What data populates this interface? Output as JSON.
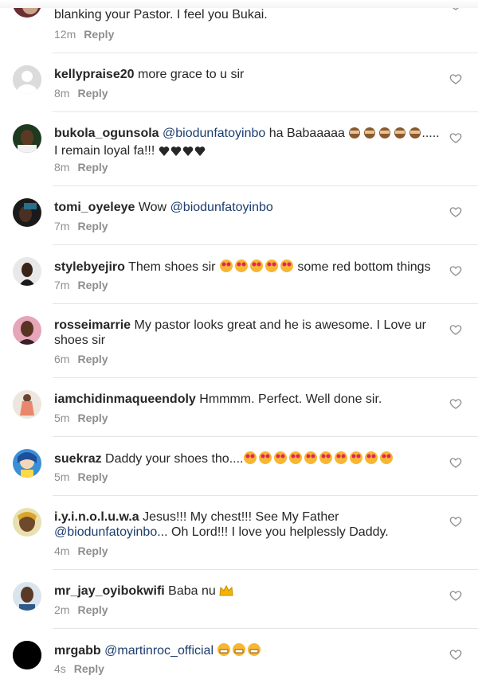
{
  "comments": [
    {
      "username": "",
      "text": "blanking your Pastor. I feel you Bukai.",
      "time": "12m",
      "reply": "Reply",
      "avatar": "profile-photo-dark"
    },
    {
      "username": "kellypraise20",
      "text": "more grace to u sir",
      "time": "8m",
      "reply": "Reply",
      "avatar": "default-avatar-gray"
    },
    {
      "username": "bukola_ogunsola",
      "mention": "@biodunfatoyinbo",
      "text": "ha Babaaaaa",
      "text_after": "..... I remain loyal fa!!!",
      "time": "8m",
      "reply": "Reply",
      "avatar": "profile-photo-woman"
    },
    {
      "username": "tomi_oyeleye",
      "text": "Wow",
      "mention": "@biodunfatoyinbo",
      "time": "7m",
      "reply": "Reply",
      "avatar": "profile-photo-dark"
    },
    {
      "username": "stylebyejiro",
      "text": "Them shoes sir",
      "text_after": "some red bottom things",
      "time": "7m",
      "reply": "Reply",
      "avatar": "profile-photo-woman"
    },
    {
      "username": "rosseimarrie",
      "text": "My pastor looks great and he is awesome. I Love ur shoes sir",
      "time": "6m",
      "reply": "Reply",
      "avatar": "profile-photo-woman-pink"
    },
    {
      "username": "iamchidinmaqueendoly",
      "text": "Hmmmm. Perfect. Well done sir.",
      "time": "5m",
      "reply": "Reply",
      "avatar": "profile-photo-light"
    },
    {
      "username": "suekraz",
      "text": "Daddy your shoes tho....",
      "time": "5m",
      "reply": "Reply",
      "avatar": "profile-photo-cartoon"
    },
    {
      "username": "i.y.i.n.o.l.u.w.a",
      "text": "Jesus!!! My chest!!! See My Father",
      "mention": "@biodunfatoyinbo",
      "text_after": "... Oh Lord!!! I love you helplessly Daddy.",
      "time": "4m",
      "reply": "Reply",
      "avatar": "profile-photo-gold"
    },
    {
      "username": "mr_jay_oyibokwifi",
      "text": "Baba nu",
      "time": "2m",
      "reply": "Reply",
      "avatar": "profile-photo-man"
    },
    {
      "username": "mrgabb",
      "mention": "@martinroc_official",
      "time": "4s",
      "reply": "Reply",
      "avatar": "profile-photo-black"
    }
  ],
  "colors": {
    "text": "#262626",
    "meta": "#8e8e8e",
    "mention": "#1c3d6e",
    "divider": "#e5e5e5"
  }
}
